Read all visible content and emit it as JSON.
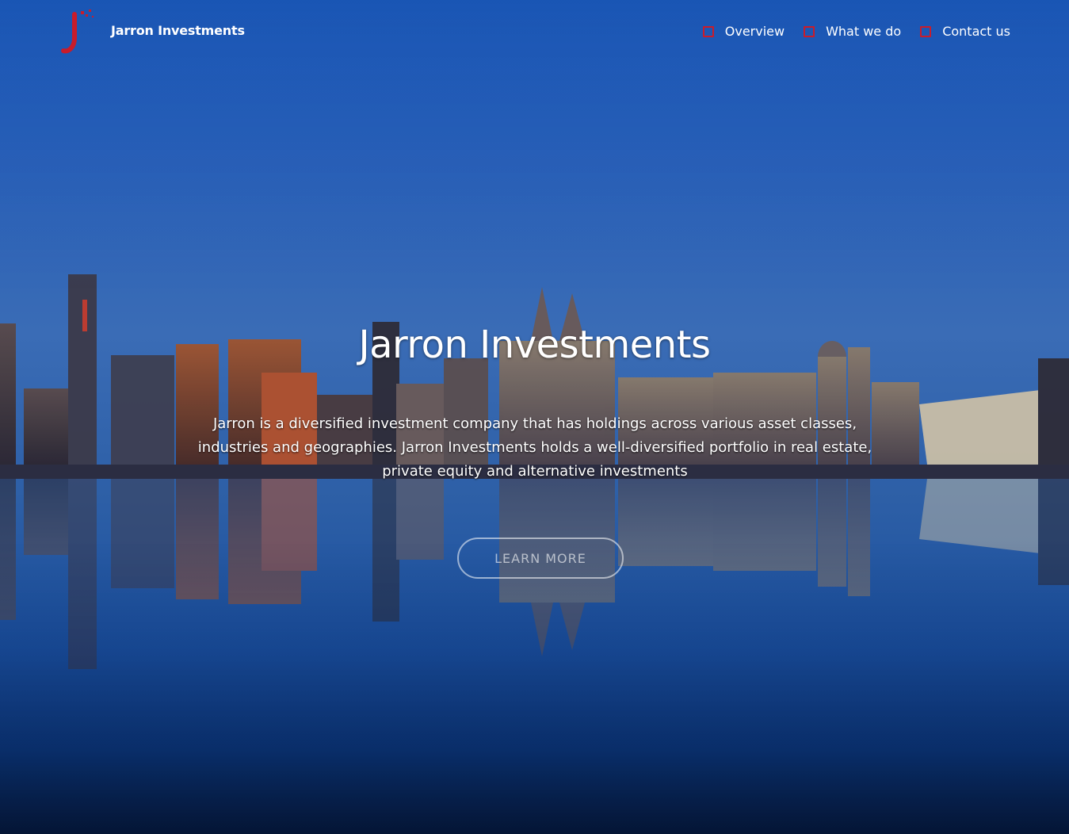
{
  "brand": {
    "name": "Jarron Investments"
  },
  "nav": {
    "items": [
      {
        "label": "Overview",
        "icon": "square-outline-icon"
      },
      {
        "label": "What we do",
        "icon": "square-outline-icon"
      },
      {
        "label": "Contact us",
        "icon": "square-outline-icon"
      }
    ]
  },
  "hero": {
    "title": "Jarron Investments",
    "description": "Jarron is a diversified investment company that has holdings across various asset classes, industries and geographies. Jarron Investments holds a well-diversified portfolio in real estate, private equity and alternative investments",
    "cta_label": "LEARN MORE"
  },
  "colors": {
    "accent": "#c91c2b",
    "sky_top": "#1b59b7",
    "sky_bottom": "#071c3d"
  }
}
